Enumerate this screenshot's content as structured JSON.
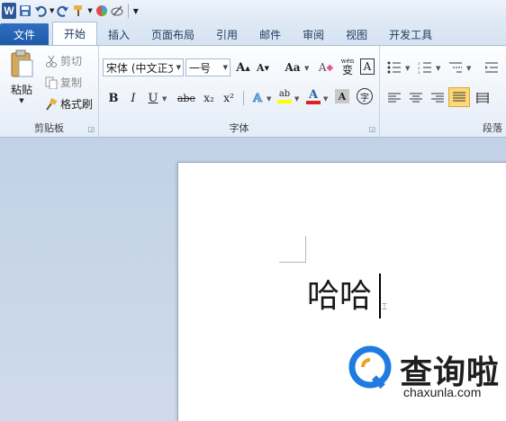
{
  "qat": {
    "app_icon": "W",
    "icons": [
      "save-icon",
      "undo-icon",
      "redo-icon",
      "format-painter-icon",
      "color-icon",
      "customize-icon"
    ]
  },
  "tabs": [
    {
      "label": "文件"
    },
    {
      "label": "开始"
    },
    {
      "label": "插入"
    },
    {
      "label": "页面布局"
    },
    {
      "label": "引用"
    },
    {
      "label": "邮件"
    },
    {
      "label": "审阅"
    },
    {
      "label": "视图"
    },
    {
      "label": "开发工具"
    }
  ],
  "clipboard": {
    "paste": "粘贴",
    "cut": "剪切",
    "copy": "复制",
    "format_painter": "格式刷",
    "label": "剪贴板"
  },
  "font": {
    "name": "宋体 (中文正文",
    "size": "一号",
    "grow": "A",
    "shrink": "A",
    "change_case": "Aa",
    "clear_format": "A",
    "phonetic": "wén",
    "phonetic_char": "变",
    "char_border": "A",
    "bold": "B",
    "italic": "I",
    "underline": "U",
    "strike": "abe",
    "subscript": "x₂",
    "superscript": "x²",
    "text_effects": "A",
    "highlight": "ab",
    "font_color": "A",
    "char_shading": "A",
    "enclose": "字",
    "label": "字体",
    "colors": {
      "highlight": "#ffff00",
      "font_color": "#e0201a"
    }
  },
  "paragraph": {
    "label": "段落"
  },
  "document": {
    "text": "哈哈"
  },
  "watermark": {
    "title": "查询啦",
    "url": "chaxunla.com",
    "color": "#1f7be0"
  }
}
